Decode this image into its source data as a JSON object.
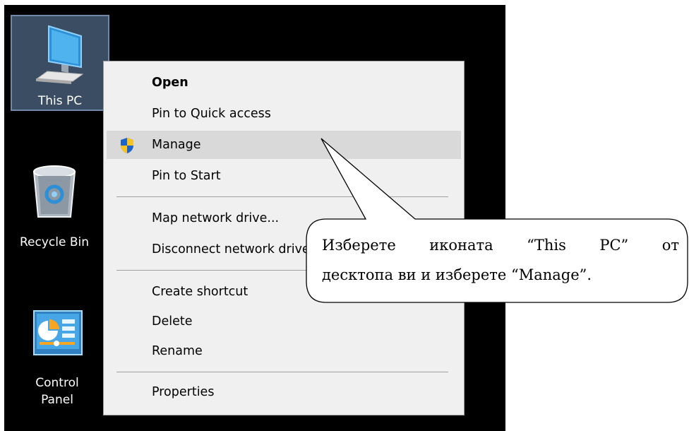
{
  "desktop": {
    "icons": [
      {
        "label": "This PC",
        "icon": "computer-icon"
      },
      {
        "label": "Recycle Bin",
        "icon": "recycle-bin-icon"
      },
      {
        "label_line1": "Control",
        "label_line2": "Panel",
        "icon": "control-panel-icon"
      }
    ]
  },
  "context_menu": {
    "items": [
      {
        "label": "Open"
      },
      {
        "label": "Pin to Quick access"
      },
      {
        "label": "Manage",
        "icon": "uac-shield-icon"
      },
      {
        "label": "Pin to Start"
      },
      {
        "label": "Map network drive..."
      },
      {
        "label": "Disconnect network drive..."
      },
      {
        "label": "Create shortcut"
      },
      {
        "label": "Delete"
      },
      {
        "label": "Rename"
      },
      {
        "label": "Properties"
      }
    ]
  },
  "callout": {
    "line1_words": [
      "Изберете",
      "иконата",
      "“This",
      "PC”",
      "от"
    ],
    "line2": "десктопа ви и изберете “Manage”."
  },
  "colors": {
    "desktop_bg": "#000000",
    "menu_bg": "#f0f0f0",
    "menu_highlight": "#d9d9d9",
    "selected_icon_bg": "#3b4d63"
  }
}
